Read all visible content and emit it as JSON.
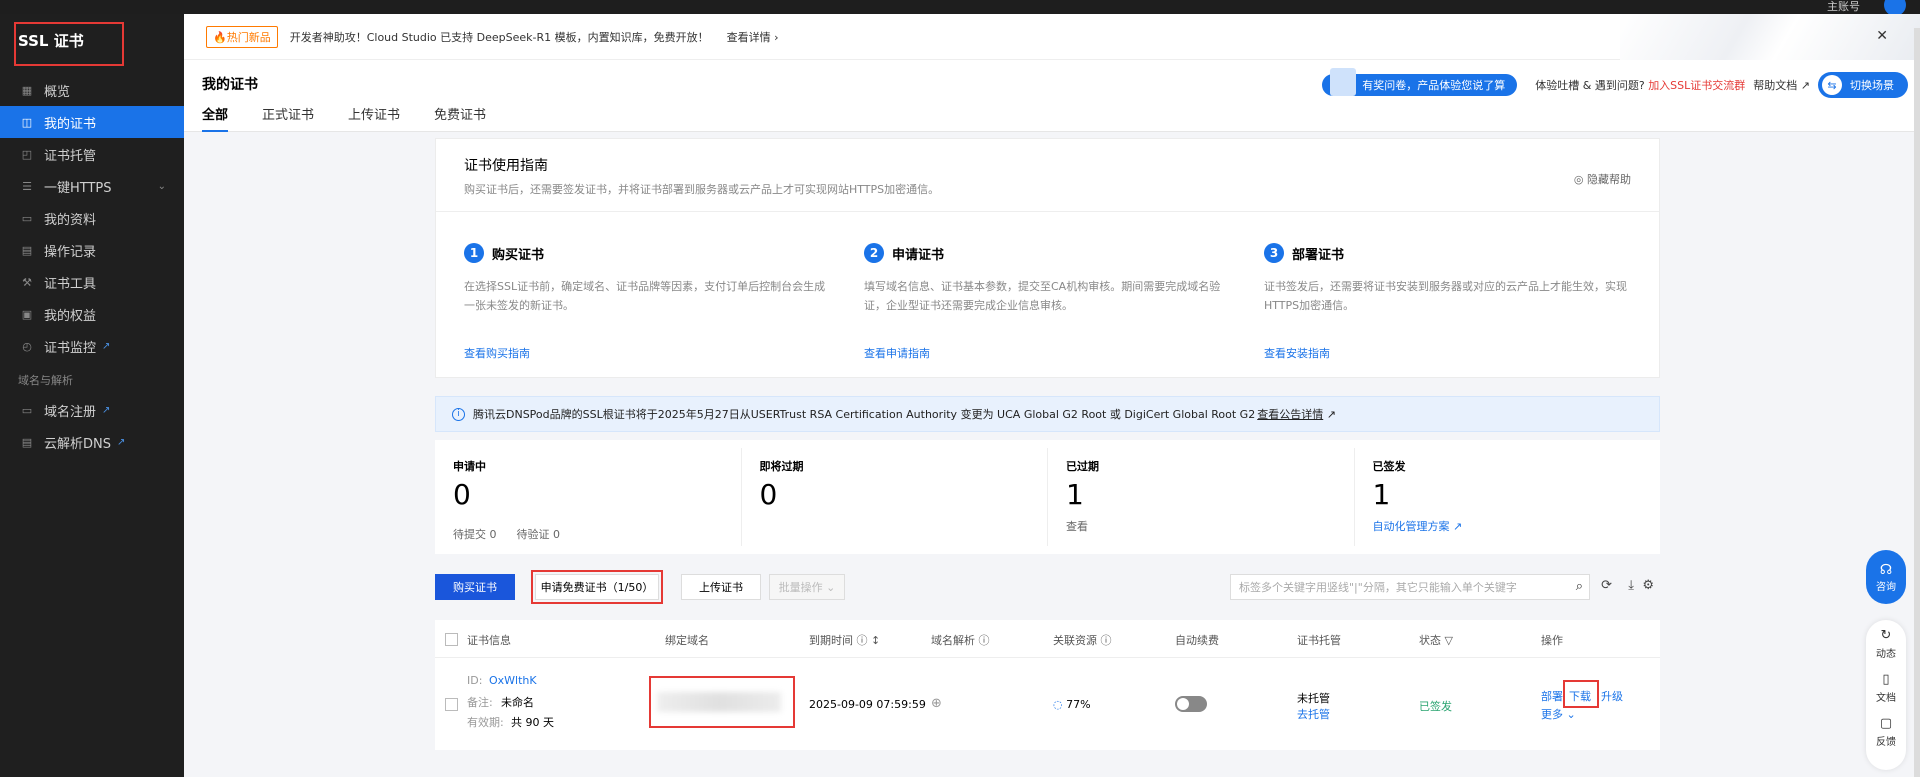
{
  "topbar": {
    "user": "主账号"
  },
  "sidebar": {
    "brand": "SSL 证书",
    "items": [
      {
        "label": "概览",
        "icon": "grid-icon",
        "active": false
      },
      {
        "label": "我的证书",
        "icon": "certificate-icon",
        "active": true
      },
      {
        "label": "证书托管",
        "icon": "managed-icon",
        "active": false
      },
      {
        "label": "一键HTTPS",
        "icon": "list-icon",
        "active": false,
        "expandable": true
      },
      {
        "label": "我的资料",
        "icon": "folder-icon",
        "active": false
      },
      {
        "label": "操作记录",
        "icon": "log-icon",
        "active": false
      },
      {
        "label": "证书工具",
        "icon": "tool-icon",
        "active": false
      },
      {
        "label": "我的权益",
        "icon": "gift-icon",
        "active": false
      },
      {
        "label": "证书监控",
        "icon": "monitor-icon",
        "active": false,
        "external": true
      }
    ],
    "section": "域名与解析",
    "section_items": [
      {
        "label": "域名注册",
        "icon": "domain-icon",
        "external": true
      },
      {
        "label": "云解析DNS",
        "icon": "dns-icon",
        "external": true
      }
    ]
  },
  "banner": {
    "tag": "🔥热门新品",
    "message": "开发者神助攻！Cloud Studio 已支持 DeepSeek-R1 模板，内置知识库，免费开放！",
    "more": "查看详情 ›",
    "close": "✕"
  },
  "header": {
    "title": "我的证书",
    "tabs": [
      "全部",
      "正式证书",
      "上传证书",
      "免费证书"
    ],
    "survey": "有奖问卷，产品体验您说了算",
    "feedback_prefix": "体验吐槽 & 遇到问题?",
    "feedback_link": "加入SSL证书交流群",
    "help_doc": "帮助文档",
    "switch": "切换场景"
  },
  "guide": {
    "title": "证书使用指南",
    "subtitle": "购买证书后，还需要签发证书，并将证书部署到服务器或云产品上才可实现网站HTTPS加密通信。",
    "hide": "隐藏帮助",
    "steps": [
      {
        "num": "1",
        "title": "购买证书",
        "desc": "在选择SSL证书前，确定域名、证书品牌等因素，支付订单后控制台会生成一张未签发的新证书。",
        "link": "查看购买指南"
      },
      {
        "num": "2",
        "title": "申请证书",
        "desc": "填写域名信息、证书基本参数，提交至CA机构审核。期间需要完成域名验证，企业型证书还需要完成企业信息审核。",
        "link": "查看申请指南"
      },
      {
        "num": "3",
        "title": "部署证书",
        "desc": "证书签发后，还需要将证书安装到服务器或对应的云产品上才能生效，实现HTTPS加密通信。",
        "link": "查看安装指南"
      }
    ]
  },
  "notice": {
    "text": "腾讯云DNSPod品牌的SSL根证书将于2025年5月27日从USERTrust RSA Certification Authority 变更为 UCA Global G2 Root 或 DigiCert Global Root G2",
    "link": "查看公告详情"
  },
  "stats": [
    {
      "label": "申请中",
      "value": "0",
      "footer": [
        "待提交 0",
        "待验证 0"
      ],
      "link": false
    },
    {
      "label": "即将过期",
      "value": "0",
      "footer": [],
      "link": false
    },
    {
      "label": "已过期",
      "value": "1",
      "footer": [
        "查看"
      ],
      "link": false
    },
    {
      "label": "已签发",
      "value": "1",
      "footer": [
        "自动化管理方案 ↗"
      ],
      "link": true
    }
  ],
  "toolbar": {
    "buy": "购买证书",
    "apply_free": "申请免费证书（1/50）",
    "upload": "上传证书",
    "batch": "批量操作 ⌄",
    "search_placeholder": "标签多个关键字用竖线\"|\"分隔，其它只能输入单个关键字"
  },
  "table": {
    "headers": [
      "证书信息",
      "绑定域名",
      "到期时间 ⓘ ↕",
      "域名解析 ⓘ",
      "关联资源 ⓘ",
      "自动续费",
      "证书托管",
      "状态 ▽",
      "操作"
    ],
    "row": {
      "id_label": "ID:",
      "id": "OxWlthK",
      "remark_label": "备注:",
      "remark": "未命名",
      "validity_label": "有效期:",
      "validity": "共 90 天",
      "expiry": "2025-09-09 07:59:59",
      "resource": "77%",
      "hosting": "未托管",
      "hosting_link": "去托管",
      "status": "已签发",
      "actions": [
        "部署",
        "下载",
        "升级"
      ],
      "more": "更多 ⌄"
    }
  },
  "float": {
    "consult": "咨询",
    "items": [
      {
        "label": "动态",
        "icon": "activity-icon"
      },
      {
        "label": "文档",
        "icon": "doc-icon"
      },
      {
        "label": "反馈",
        "icon": "feedback-icon"
      }
    ]
  },
  "colors": {
    "accent": "#1a73e8",
    "danger": "#e53935",
    "success": "#2ba471",
    "sidebar": "#1f1f1f"
  }
}
